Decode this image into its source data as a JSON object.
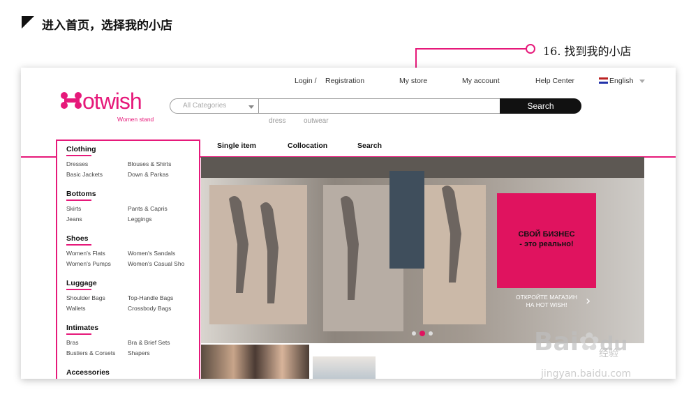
{
  "instruction": {
    "title": "进入首页，选择我的小店",
    "callout": "16. 找到我的小店",
    "accent_color": "#e6197a"
  },
  "site": {
    "logo_text": "otwish",
    "logo_sub": "Women stand",
    "top_links": {
      "login": "Login /",
      "registration": "Registration",
      "my_store": "My store",
      "my_account": "My account",
      "help_center": "Help Center",
      "language": "English"
    },
    "search": {
      "category_placeholder": "All Categories",
      "button_label": "Search",
      "hints": [
        "dress",
        "outwear"
      ]
    },
    "nav": {
      "single_item": "Single item",
      "collocation": "Collocation",
      "search": "Search"
    },
    "categories": [
      {
        "title": "Clothing",
        "items": [
          "Dresses",
          "Blouses & Shirts",
          "Basic Jackets",
          "Down & Parkas"
        ]
      },
      {
        "title": "Bottoms",
        "items": [
          "Skirts",
          "Pants & Capris",
          "Jeans",
          "Leggings"
        ]
      },
      {
        "title": "Shoes",
        "items": [
          "Women's Flats",
          "Women's Sandals",
          "Women's Pumps",
          "Women's Casual Sho"
        ]
      },
      {
        "title": "Luggage",
        "items": [
          "Shoulder Bags",
          "Top-Handle Bags",
          "Wallets",
          "Crossbody Bags"
        ]
      },
      {
        "title": "Intimates",
        "items": [
          "Bras",
          "Bra & Brief Sets",
          "Bustiers & Corsets",
          "Shapers"
        ]
      },
      {
        "title": "Accessories",
        "items": []
      }
    ],
    "banner": {
      "headline_line1": "СВОЙ БИЗНЕС",
      "headline_line2": "- это реально!",
      "cta_line1": "ОТКРОЙТЕ МАГАЗИН",
      "cta_line2": "НА HOT WISH!",
      "accent_color": "#e0135f"
    }
  },
  "watermark": {
    "brand": "Bai",
    "brand_cn": "经验",
    "url": "jingyan.baidu.com"
  }
}
